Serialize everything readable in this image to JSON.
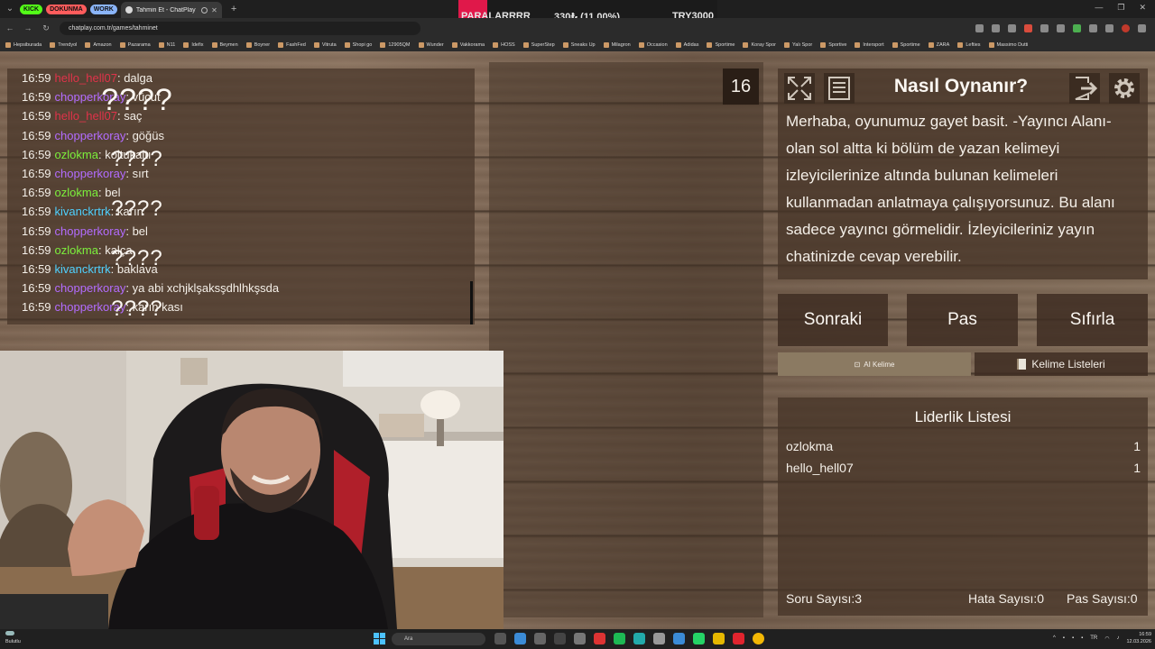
{
  "browser": {
    "tab_groups": [
      {
        "label": "KICK",
        "color": "#53fc18"
      },
      {
        "label": "DOKUNMA",
        "color": "#ff5c5c"
      },
      {
        "label": "WORK",
        "color": "#8ab4f8"
      }
    ],
    "active_tab_title": "Tahmin Et - ChatPlay",
    "url": "chatplay.com.tr/games/tahminet",
    "bookmarks": [
      "Hepsiburada",
      "Trendyol",
      "Amazon",
      "Pazarama",
      "N11",
      "Idefix",
      "Beymen",
      "Boyner",
      "FashFed",
      "Vitruta",
      "Shopi go",
      "12905QM",
      "Wunder",
      "Vakkorama",
      "HOSS",
      "SuperStep",
      "Sneaks Up",
      "Milagron",
      "Occasion",
      "Adidas",
      "Sportime",
      "Koray Spor",
      "Yalı Spor",
      "Sportive",
      "Intersport",
      "Sportime",
      "ZARA",
      "Lefties",
      "Massimo Dutti"
    ]
  },
  "ticker": {
    "name": "PARALARRRR",
    "change": "330₺ (11.00%)",
    "symbol": "TRY3000",
    "accent": "#e0184a"
  },
  "chat": {
    "messages": [
      {
        "time": "16:59",
        "user": "hello_hell07",
        "color": "#e0334a",
        "text": "dalga"
      },
      {
        "time": "16:59",
        "user": "chopperkoray",
        "color": "#b36cff",
        "text": "vücut"
      },
      {
        "time": "16:59",
        "user": "hello_hell07",
        "color": "#e0334a",
        "text": "saç"
      },
      {
        "time": "16:59",
        "user": "chopperkoray",
        "color": "#b36cff",
        "text": "göğüs"
      },
      {
        "time": "16:59",
        "user": "ozlokma",
        "color": "#7cf03c",
        "text": "koltukaltı"
      },
      {
        "time": "16:59",
        "user": "chopperkoray",
        "color": "#b36cff",
        "text": "sırt"
      },
      {
        "time": "16:59",
        "user": "ozlokma",
        "color": "#7cf03c",
        "text": "bel"
      },
      {
        "time": "16:59",
        "user": "kivanckrtrk",
        "color": "#4fd1ff",
        "text": "karın"
      },
      {
        "time": "16:59",
        "user": "chopperkoray",
        "color": "#b36cff",
        "text": "bel"
      },
      {
        "time": "16:59",
        "user": "ozlokma",
        "color": "#7cf03c",
        "text": "kalça"
      },
      {
        "time": "16:59",
        "user": "kivanckrtrk",
        "color": "#4fd1ff",
        "text": "baklava"
      },
      {
        "time": "16:59",
        "user": "chopperkoray",
        "color": "#b36cff",
        "text": "ya abi xchjklşaksşdhlhkşsda"
      },
      {
        "time": "16:59",
        "user": "chopperkoray",
        "color": "#b36cff",
        "text": "karın kası"
      }
    ]
  },
  "game": {
    "main_word": "????",
    "forbidden_words": [
      "????",
      "????",
      "????",
      "????",
      "????"
    ],
    "timer": "16"
  },
  "info": {
    "title": "Nasıl Oynanır?",
    "text": "Merhaba, oyunumuz gayet basit. -Yayıncı Alanı- olan sol altta ki bölüm de yazan kelimeyi izleyicilerinize altında bulunan kelimeleri kullanmadan anlatmaya çalışıyorsunuz. Bu alanı sadece yayıncı görmelidir. İzleyicileriniz yayın chatinizde cevap verebilir."
  },
  "controls": {
    "next": "Sonraki",
    "pass": "Pas",
    "reset": "Sıfırla",
    "ai_word": "AI Kelime",
    "word_lists": "Kelime Listeleri"
  },
  "leaderboard": {
    "title": "Liderlik Listesi",
    "rows": [
      {
        "name": "ozlokma",
        "score": "1"
      },
      {
        "name": "hello_hell07",
        "score": "1"
      }
    ]
  },
  "stats": {
    "questions": "Soru Sayısı:3",
    "errors": "Hata Sayısı:0",
    "passes": "Pas Sayısı:0"
  },
  "taskbar": {
    "weather": "Bulutlu",
    "search_placeholder": "Ara",
    "time": "16:59",
    "date": "12.03.2026"
  }
}
